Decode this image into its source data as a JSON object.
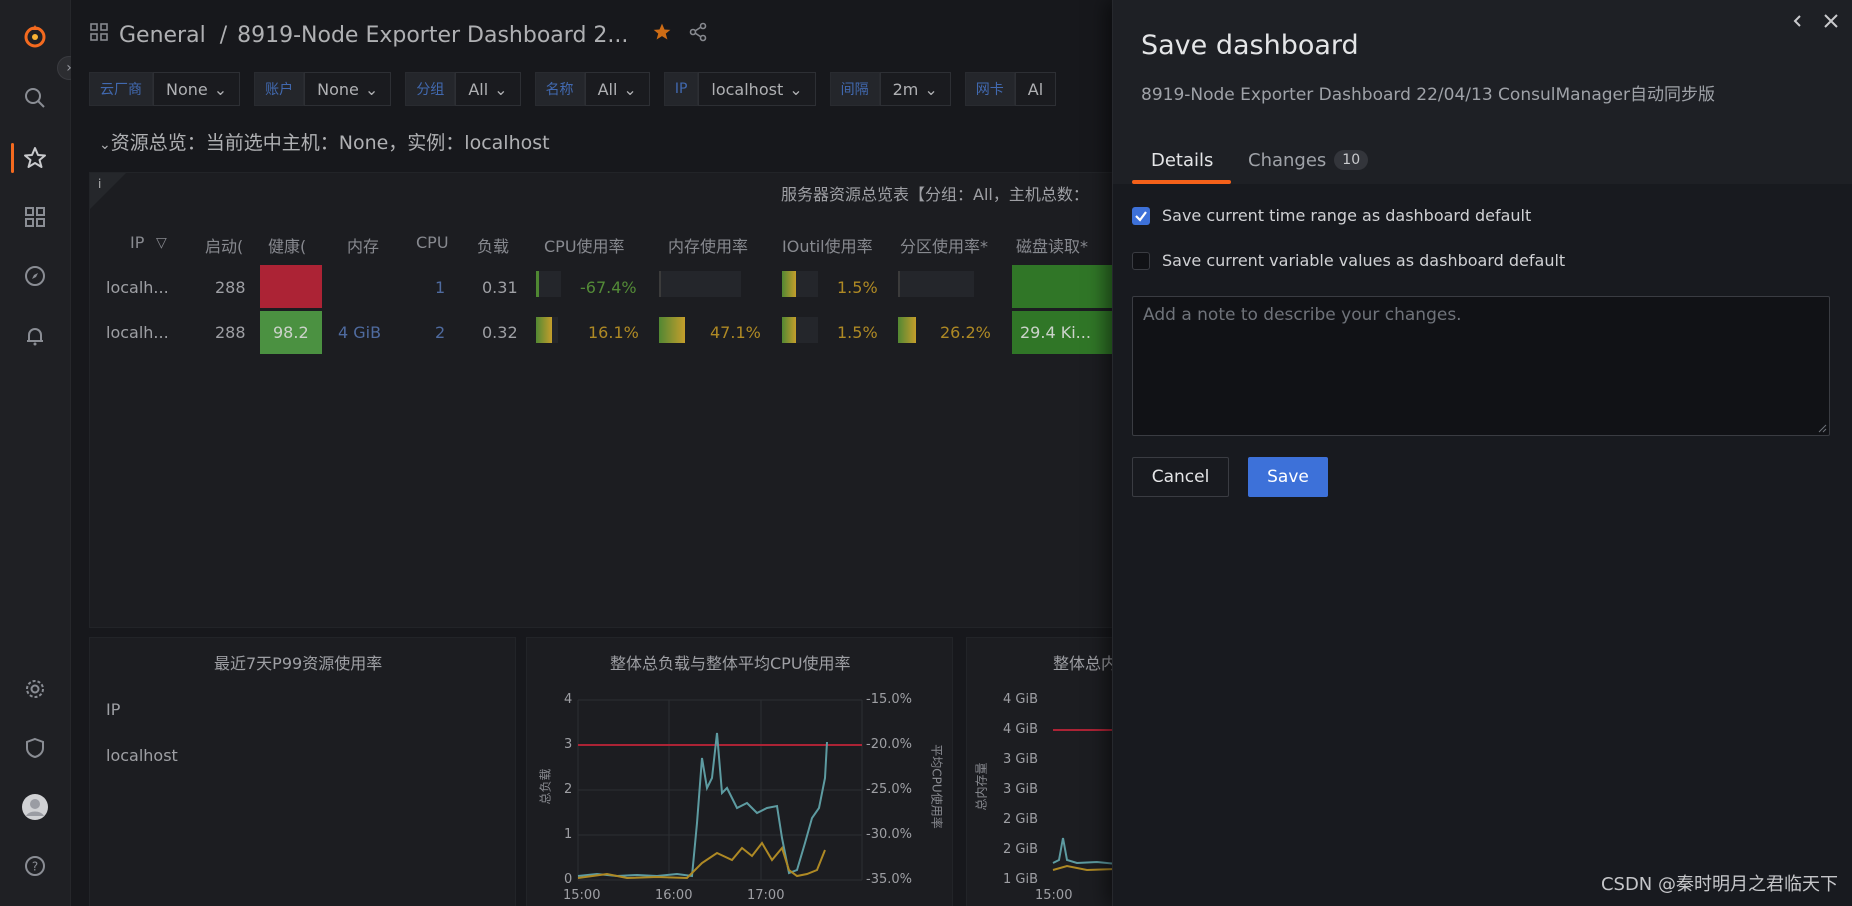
{
  "sidebar": {
    "items": [
      {
        "icon": "grafana-logo-icon"
      },
      {
        "icon": "search-icon"
      },
      {
        "icon": "star-icon"
      },
      {
        "icon": "dashboards-grid-icon"
      },
      {
        "icon": "explore-compass-icon"
      },
      {
        "icon": "alerting-bell-icon"
      },
      {
        "icon": "gear-icon"
      },
      {
        "icon": "shield-icon"
      },
      {
        "icon": "avatar"
      },
      {
        "icon": "help-icon"
      }
    ],
    "active_color": "#f46a1f"
  },
  "topbar": {
    "breadcrumb_root": "General",
    "breadcrumb_sep": "/",
    "dashboard_title": "8919-Node Exporter Dashboard 2..."
  },
  "variables": [
    {
      "label": "云厂商",
      "value": "None"
    },
    {
      "label": "账户",
      "value": "None"
    },
    {
      "label": "分组",
      "value": "All"
    },
    {
      "label": "名称",
      "value": "All"
    },
    {
      "label": "IP",
      "value": "localhost"
    },
    {
      "label": "间隔",
      "value": "2m"
    },
    {
      "label": "网卡",
      "value": "Al"
    }
  ],
  "row_title": "资源总览：当前选中主机：None，实例：localhost",
  "overview_panel": {
    "title": "服务器资源总览表【分组：All，主机总数：",
    "info": "i",
    "columns": [
      "IP",
      "启动(",
      "健康(",
      "内存",
      "CPU",
      "负载",
      "CPU使用率",
      "内存使用率",
      "IOutil使用率",
      "分区使用率*",
      "磁盘读取*"
    ],
    "rows": [
      {
        "ip": "localh...",
        "uptime": "288",
        "health": "",
        "memory": "",
        "cpu": "1",
        "load": "0.31",
        "cpu_usage": "-67.4%",
        "mem_usage": "",
        "ioutil": "1.5%",
        "partition": "",
        "disk_read": ""
      },
      {
        "ip": "localh...",
        "uptime": "288",
        "health": "98.2",
        "memory": "4 GiB",
        "cpu": "2",
        "load": "0.32",
        "cpu_usage": "16.1%",
        "mem_usage": "47.1%",
        "ioutil": "1.5%",
        "partition": "26.2%",
        "disk_read": "29.4 Ki..."
      }
    ]
  },
  "p99_panel": {
    "title": "最近7天P99资源使用率",
    "col_header": "IP",
    "row_value": "localhost"
  },
  "load_panel": {
    "title": "整体总负载与整体平均CPU使用率",
    "y_left_label": "总负载",
    "y_right_label": "平均CPU使用率",
    "y_left_ticks": [
      "4",
      "3",
      "2",
      "1",
      "0"
    ],
    "y_right_ticks": [
      "-15.0%",
      "-20.0%",
      "-25.0%",
      "-30.0%",
      "-35.0%"
    ],
    "x_ticks": [
      "15:00",
      "16:00",
      "17:00"
    ]
  },
  "mem_panel": {
    "title": "整体总内",
    "y_label": "总内存量",
    "y_ticks": [
      "4 GiB",
      "4 GiB",
      "3 GiB",
      "3 GiB",
      "2 GiB",
      "2 GiB",
      "1 GiB"
    ],
    "x_ticks": [
      "15:00"
    ]
  },
  "drawer": {
    "title": "Save dashboard",
    "subtitle": "8919-Node Exporter Dashboard 22/04/13 ConsulManager自动同步版",
    "tabs": [
      {
        "label": "Details",
        "active": true
      },
      {
        "label": "Changes",
        "count": "10"
      }
    ],
    "save_time_range_label": "Save current time range as dashboard default",
    "save_time_range_checked": true,
    "save_variables_label": "Save current variable values as dashboard default",
    "save_variables_checked": false,
    "note_placeholder": "Add a note to describe your changes.",
    "cancel_label": "Cancel",
    "save_label": "Save",
    "accent": "#3d71d9",
    "tab_accent": "#f4611a"
  },
  "watermark": "CSDN @秦时明月之君临天下"
}
